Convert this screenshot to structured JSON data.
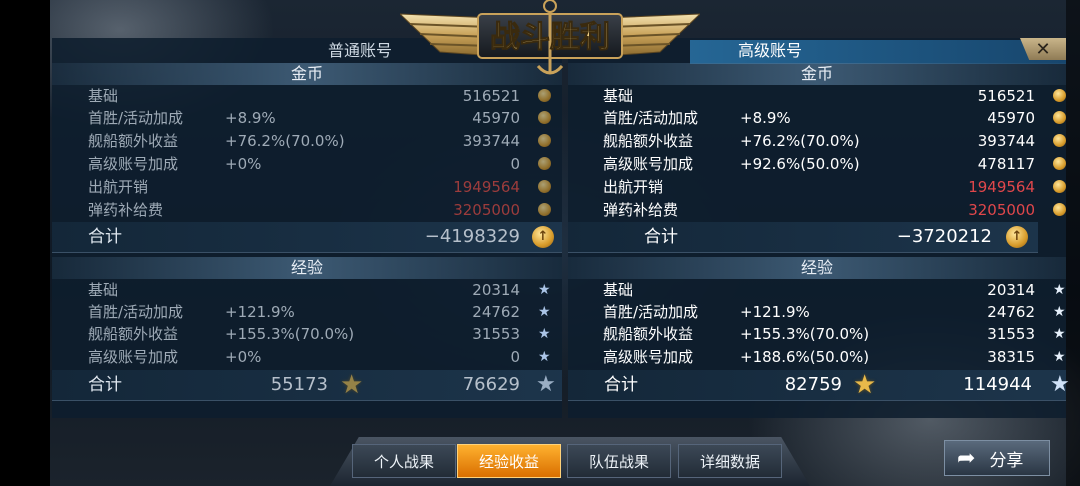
{
  "banner": {
    "title": "战斗胜利"
  },
  "accounts": {
    "normal_title": "普通账号",
    "premium_title": "高级账号"
  },
  "close_symbol": "✕",
  "gold": {
    "section_title": "金币",
    "rows": [
      {
        "label": "基础",
        "n_pct": "",
        "n_val": "516521",
        "p_pct": "",
        "p_val": "516521"
      },
      {
        "label": "首胜/活动加成",
        "n_pct": "+8.9%",
        "n_val": "45970",
        "p_pct": "+8.9%",
        "p_val": "45970"
      },
      {
        "label": "舰船额外收益",
        "n_pct": "+76.2%(70.0%)",
        "n_val": "393744",
        "p_pct": "+76.2%(70.0%)",
        "p_val": "393744"
      },
      {
        "label": "高级账号加成",
        "n_pct": "+0%",
        "n_val": "0",
        "p_pct": "+92.6%(50.0%)",
        "p_val": "478117"
      },
      {
        "label": "出航开销",
        "n_pct": "",
        "n_val": "1949564",
        "p_pct": "",
        "p_val": "1949564"
      },
      {
        "label": "弹药补给费",
        "n_pct": "",
        "n_val": "3205000",
        "p_pct": "",
        "p_val": "3205000"
      }
    ],
    "total_label": "合计",
    "n_total": "−4198329",
    "p_total": "−3720212"
  },
  "exp": {
    "section_title": "经验",
    "rows": [
      {
        "label": "基础",
        "n_pct": "",
        "n_val": "20314",
        "p_pct": "",
        "p_val": "20314"
      },
      {
        "label": "首胜/活动加成",
        "n_pct": "+121.9%",
        "n_val": "24762",
        "p_pct": "+121.9%",
        "p_val": "24762"
      },
      {
        "label": "舰船额外收益",
        "n_pct": "+155.3%(70.0%)",
        "n_val": "31553",
        "p_pct": "+155.3%(70.0%)",
        "p_val": "31553"
      },
      {
        "label": "高级账号加成",
        "n_pct": "+0%",
        "n_val": "0",
        "p_pct": "+188.6%(50.0%)",
        "p_val": "38315"
      }
    ],
    "total_label": "合计",
    "n_total_a": "55173",
    "n_total_b": "76629",
    "p_total_a": "82759",
    "p_total_b": "114944"
  },
  "tabs": [
    "个人战果",
    "经验收益",
    "队伍战果",
    "详细数据"
  ],
  "active_tab": 1,
  "share_label": "分享",
  "colors": {
    "accent": "#ff9a1a",
    "cost_red": "#e0474b",
    "panel": "#0e1e2e"
  },
  "icons": {
    "coin": "coin-icon",
    "star": "star-icon",
    "gold_star": "gold-star-icon",
    "back": "back-arrow-icon",
    "close": "close-icon"
  }
}
